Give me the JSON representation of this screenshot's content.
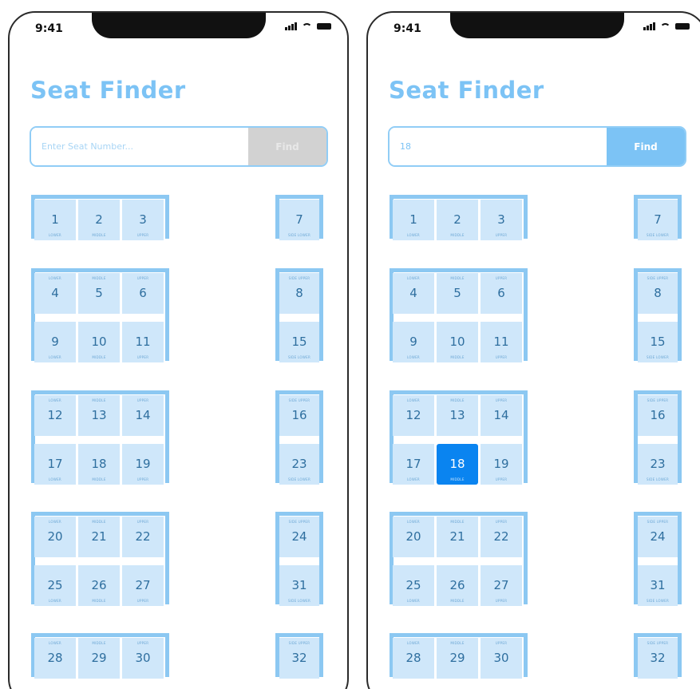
{
  "status": {
    "time": "9:41"
  },
  "title": "Seat Finder",
  "find_label": "Find",
  "placeholder": "Enter Seat Number...",
  "screens": [
    {
      "name": "before",
      "value": "",
      "find_enabled": false,
      "selected_seat": null
    },
    {
      "name": "after",
      "value": "18",
      "find_enabled": true,
      "selected_seat": 18
    }
  ],
  "berth_labels": {
    "lower": "LOWER",
    "middle": "MIDDLE",
    "upper": "UPPER",
    "side_lower": "SIDE LOWER",
    "side_upper": "SIDE UPPER"
  },
  "bays": [
    {
      "main": [
        [
          1,
          2,
          3
        ]
      ],
      "side": [
        7
      ]
    },
    {
      "main": [
        [
          4,
          5,
          6
        ],
        [
          9,
          10,
          11
        ]
      ],
      "side": [
        8,
        15
      ]
    },
    {
      "main": [
        [
          12,
          13,
          14
        ],
        [
          17,
          18,
          19
        ]
      ],
      "side": [
        16,
        23
      ]
    },
    {
      "main": [
        [
          20,
          21,
          22
        ],
        [
          25,
          26,
          27
        ]
      ],
      "side": [
        24,
        31
      ]
    },
    {
      "main": [
        [
          28,
          29,
          30
        ]
      ],
      "side": [
        32
      ]
    }
  ],
  "colors": {
    "accent": "#7cc3f5",
    "seat": "#cfe7fa",
    "selected": "#0a84f0",
    "rail": "#8cc8f2"
  }
}
